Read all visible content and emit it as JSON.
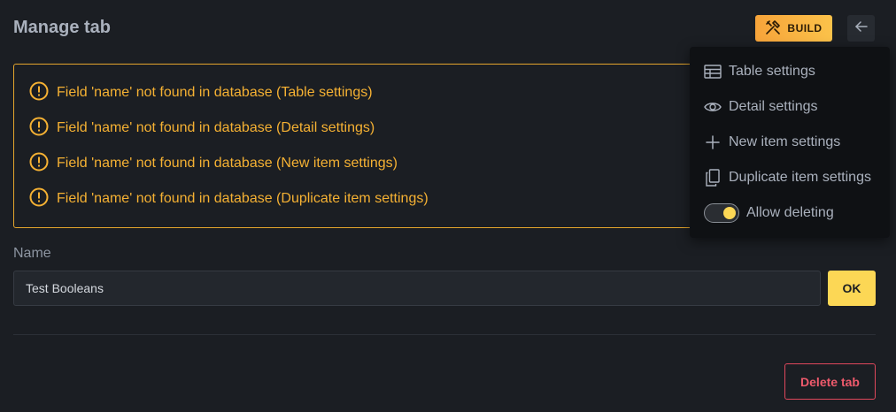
{
  "header": {
    "title": "Manage tab",
    "build_label": "BUILD"
  },
  "alerts": [
    "Field 'name' not found in database (Table settings)",
    "Field 'name' not found in database (Detail settings)",
    "Field 'name' not found in database (New item settings)",
    "Field 'name' not found in database (Duplicate item settings)"
  ],
  "form": {
    "name_label": "Name",
    "name_value": "Test Booleans",
    "ok_label": "OK",
    "delete_label": "Delete tab"
  },
  "menu": {
    "items": [
      {
        "label": "Table settings",
        "icon": "table-icon"
      },
      {
        "label": "Detail settings",
        "icon": "eye-icon"
      },
      {
        "label": "New item settings",
        "icon": "plus-icon"
      },
      {
        "label": "Duplicate item settings",
        "icon": "copy-icon"
      }
    ],
    "toggle_label": "Allow deleting",
    "toggle_on": true
  },
  "colors": {
    "background": "#1b1e23",
    "warning": "#f5b133",
    "accent": "#fcd755",
    "danger": "#ef5a6c"
  }
}
